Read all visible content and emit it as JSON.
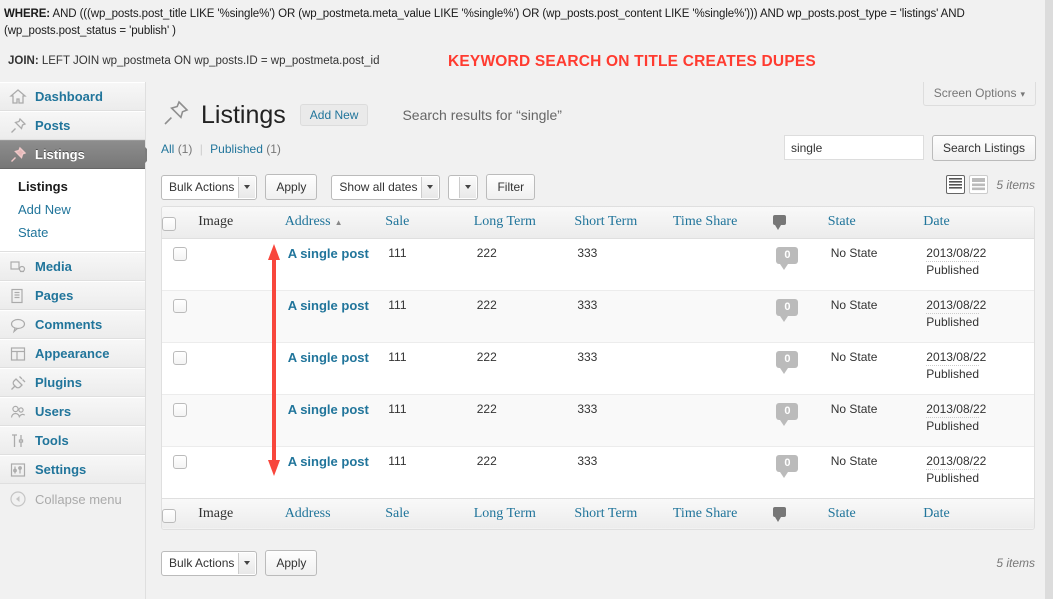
{
  "annotations": {
    "where_label": "WHERE:",
    "where_text": " AND (((wp_posts.post_title LIKE '%single%') OR (wp_postmeta.meta_value LIKE '%single%') OR (wp_posts.post_content LIKE '%single%'))) AND wp_posts.post_type = 'listings' AND",
    "where_text_line2": "(wp_posts.post_status = 'publish' )",
    "join_label": "JOIN:",
    "join_text": " LEFT JOIN wp_postmeta ON wp_posts.ID = wp_postmeta.post_id",
    "red_note": "KEYWORD SEARCH ON TITLE CREATES DUPES",
    "red_color": "#ff3b30",
    "arrow_name": "duplicate-rows-arrow"
  },
  "sidebar": {
    "items": [
      {
        "label": "Dashboard",
        "icon": "dashboard-icon",
        "active": false
      },
      {
        "label": "Posts",
        "icon": "pin-icon",
        "active": false
      },
      {
        "label": "Listings",
        "icon": "pin-icon",
        "active": true
      },
      {
        "label": "Media",
        "icon": "media-icon",
        "active": false
      },
      {
        "label": "Pages",
        "icon": "pages-icon",
        "active": false
      },
      {
        "label": "Comments",
        "icon": "comment-icon",
        "active": false
      },
      {
        "label": "Appearance",
        "icon": "appearance-icon",
        "active": false
      },
      {
        "label": "Plugins",
        "icon": "plug-icon",
        "active": false
      },
      {
        "label": "Users",
        "icon": "users-icon",
        "active": false
      },
      {
        "label": "Tools",
        "icon": "tools-icon",
        "active": false
      },
      {
        "label": "Settings",
        "icon": "settings-icon",
        "active": false
      }
    ],
    "submenu": [
      {
        "label": "Listings",
        "current": true
      },
      {
        "label": "Add New",
        "current": false
      },
      {
        "label": "State",
        "current": false
      }
    ],
    "collapse_label": "Collapse menu"
  },
  "header": {
    "screen_options": "Screen Options",
    "screen_options_caret": "▾",
    "title": "Listings",
    "add_new": "Add New",
    "search_results": "Search results for “single”"
  },
  "filters": {
    "all_label": "All",
    "all_count": "(1)",
    "separator": "|",
    "published_label": "Published",
    "published_count": "(1)"
  },
  "search": {
    "value": "single",
    "placeholder": "",
    "button": "Search Listings"
  },
  "toolbar": {
    "bulk_actions": "Bulk Actions",
    "apply": "Apply",
    "show_dates": "Show all dates",
    "extra_select": "",
    "filter": "Filter",
    "items_count": "5 items"
  },
  "toolbar_bottom": {
    "bulk_actions": "Bulk Actions",
    "apply": "Apply",
    "items_count": "5 items"
  },
  "table": {
    "columns": [
      "Image",
      "Address",
      "Sale",
      "Long Term",
      "Short Term",
      "Time Share",
      "comment-icon",
      "State",
      "Date"
    ],
    "sorted_column": "Address",
    "sort_indicator": "▲",
    "rows": [
      {
        "title": "A single post",
        "sale": "111",
        "long_term": "222",
        "short_term": "333",
        "time_share": "",
        "comments": "0",
        "state": "No State",
        "date": "2013/08/22",
        "status": "Published"
      },
      {
        "title": "A single post",
        "sale": "111",
        "long_term": "222",
        "short_term": "333",
        "time_share": "",
        "comments": "0",
        "state": "No State",
        "date": "2013/08/22",
        "status": "Published"
      },
      {
        "title": "A single post",
        "sale": "111",
        "long_term": "222",
        "short_term": "333",
        "time_share": "",
        "comments": "0",
        "state": "No State",
        "date": "2013/08/22",
        "status": "Published"
      },
      {
        "title": "A single post",
        "sale": "111",
        "long_term": "222",
        "short_term": "333",
        "time_share": "",
        "comments": "0",
        "state": "No State",
        "date": "2013/08/22",
        "status": "Published"
      },
      {
        "title": "A single post",
        "sale": "111",
        "long_term": "222",
        "short_term": "333",
        "time_share": "",
        "comments": "0",
        "state": "No State",
        "date": "2013/08/22",
        "status": "Published"
      }
    ]
  },
  "colors": {
    "link": "#21759b",
    "sidebar_active_bg": "#7d7d7d",
    "annotation_red": "#ff3b30"
  }
}
